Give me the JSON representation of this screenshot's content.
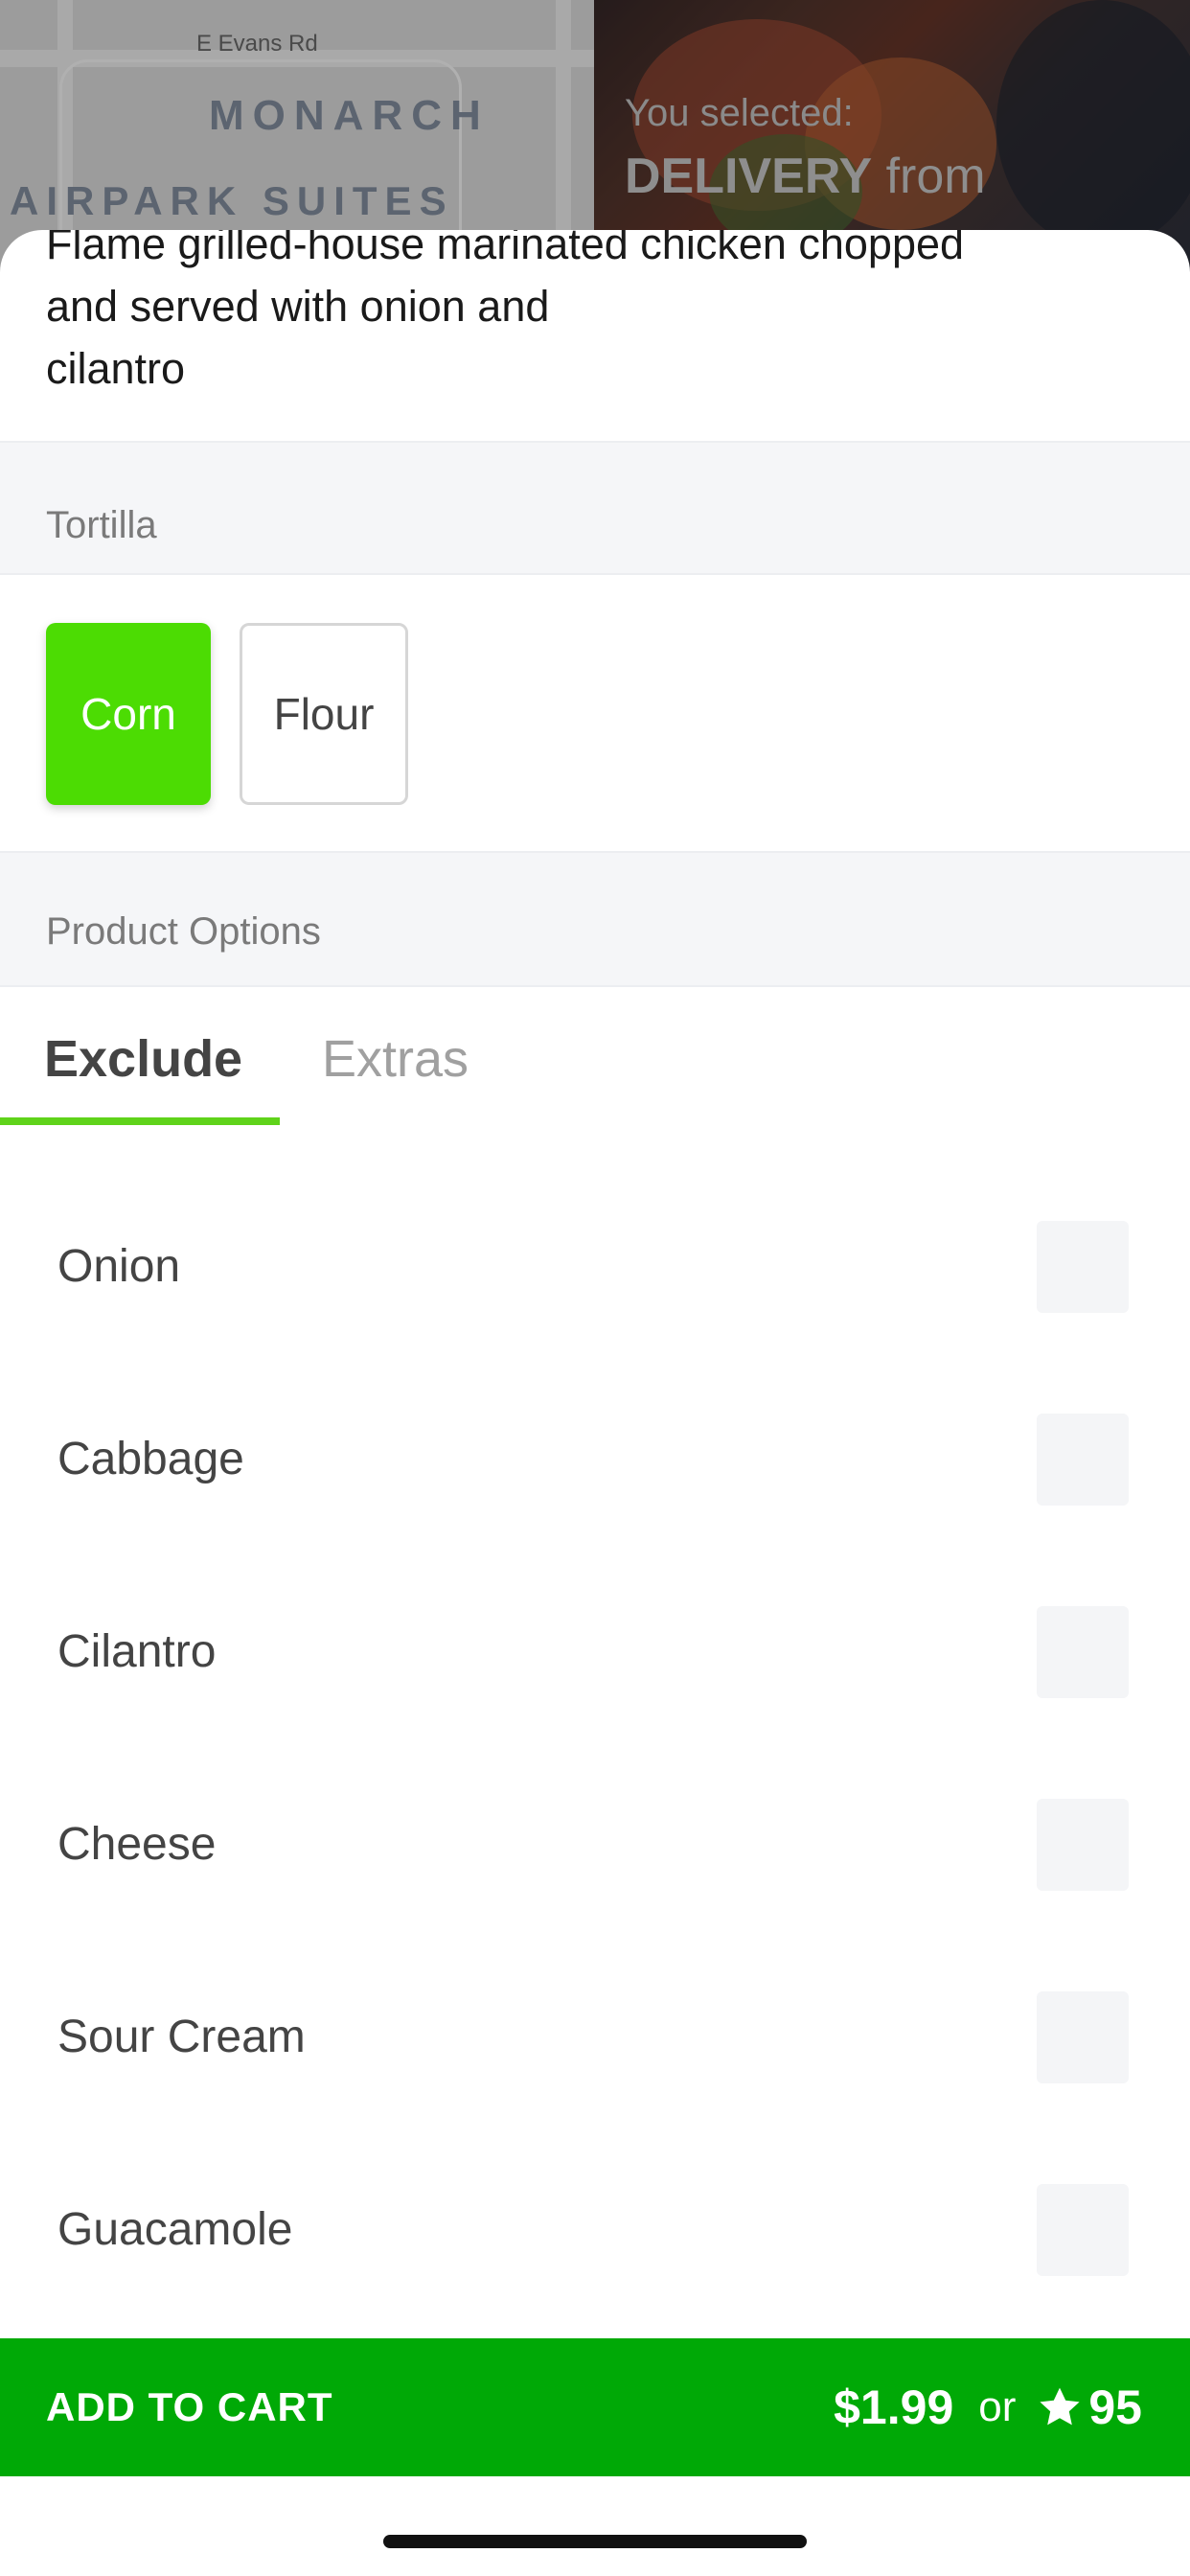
{
  "background": {
    "map": {
      "street_label": "E Evans Rd",
      "area_label_1": "MONARCH",
      "area_label_2": "AIRPARK SUITES"
    },
    "selection": {
      "prefix": "You selected:",
      "mode": "DELIVERY",
      "suffix": "from"
    }
  },
  "product": {
    "description_lines": [
      "Flame grilled-house marinated chicken chopped",
      "and served with onion and",
      "cilantro"
    ]
  },
  "tortilla": {
    "title": "Tortilla",
    "options": [
      {
        "label": "Corn",
        "selected": true
      },
      {
        "label": "Flour",
        "selected": false
      }
    ]
  },
  "product_options": {
    "title": "Product Options",
    "tabs": [
      {
        "label": "Exclude",
        "active": true
      },
      {
        "label": "Extras",
        "active": false
      }
    ],
    "exclude_items": [
      {
        "label": "Onion",
        "checked": false
      },
      {
        "label": "Cabbage",
        "checked": false
      },
      {
        "label": "Cilantro",
        "checked": false
      },
      {
        "label": "Cheese",
        "checked": false
      },
      {
        "label": "Sour Cream",
        "checked": false
      },
      {
        "label": "Guacamole",
        "checked": false
      }
    ]
  },
  "cart": {
    "label": "ADD TO CART",
    "price": "$1.99",
    "or": "or",
    "points": "95",
    "icon": "star-icon"
  },
  "colors": {
    "accent_green": "#4cdc03",
    "cart_green": "#00a906",
    "tab_underline": "#5fd31a"
  }
}
